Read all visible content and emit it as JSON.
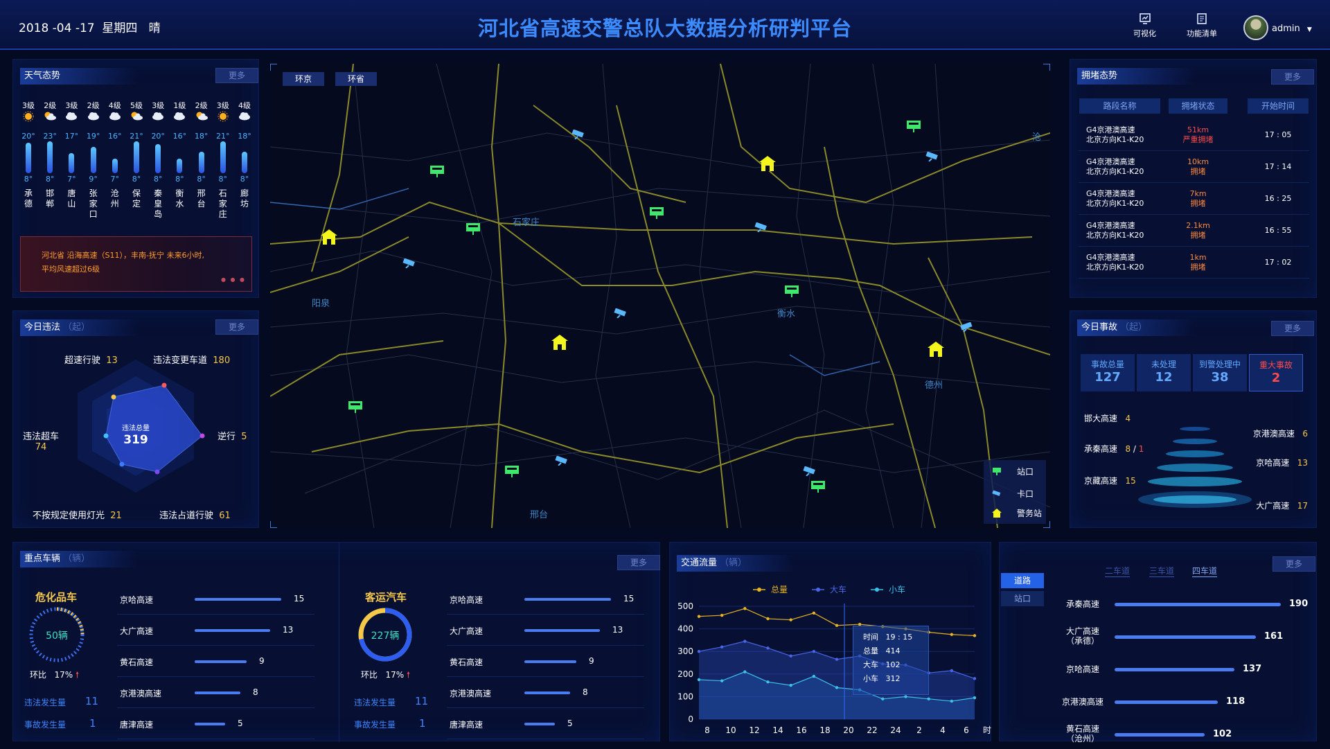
{
  "header": {
    "date": "2018 -04 -17",
    "weekday": "星期四",
    "weather": "晴",
    "title": "河北省高速交警总队大数据分析研判平台",
    "nav_visual": "可视化",
    "nav_functions": "功能清单",
    "user": "admin"
  },
  "weather_panel": {
    "title": "天气态势",
    "more": "更多",
    "cities": [
      {
        "level": "3级",
        "icon": "sun",
        "high": "20°",
        "low": "8°",
        "name": [
          "承",
          "德"
        ],
        "hf": 0.95
      },
      {
        "level": "2级",
        "icon": "partly-cloudy",
        "high": "23°",
        "low": "8°",
        "name": [
          "邯",
          "郸"
        ],
        "hf": 1.0
      },
      {
        "level": "3级",
        "icon": "cloud",
        "high": "17°",
        "low": "7°",
        "name": [
          "唐",
          "山"
        ],
        "hf": 0.55
      },
      {
        "level": "2级",
        "icon": "cloud",
        "high": "19°",
        "low": "9°",
        "name": [
          "张",
          "家",
          "口"
        ],
        "hf": 0.8
      },
      {
        "level": "4级",
        "icon": "cloud",
        "high": "16°",
        "low": "7°",
        "name": [
          "沧",
          "州"
        ],
        "hf": 0.35
      },
      {
        "level": "5级",
        "icon": "partly-cloudy",
        "high": "21°",
        "low": "8°",
        "name": [
          "保",
          "定"
        ],
        "hf": 1.0
      },
      {
        "level": "3级",
        "icon": "cloud",
        "high": "20°",
        "low": "8°",
        "name": [
          "秦",
          "皇",
          "岛"
        ],
        "hf": 0.9
      },
      {
        "level": "1级",
        "icon": "cloud",
        "high": "16°",
        "low": "8°",
        "name": [
          "衡",
          "水"
        ],
        "hf": 0.35
      },
      {
        "level": "2级",
        "icon": "partly-cloudy",
        "high": "18°",
        "low": "8°",
        "name": [
          "邢",
          "台"
        ],
        "hf": 0.6
      },
      {
        "level": "3级",
        "icon": "sun",
        "high": "21°",
        "low": "8°",
        "name": [
          "石",
          "家",
          "庄"
        ],
        "hf": 1.0
      },
      {
        "level": "4级",
        "icon": "cloud",
        "high": "18°",
        "low": "8°",
        "name": [
          "廊",
          "坊"
        ],
        "hf": 0.6
      }
    ],
    "alert_line1": "河北省  沿海高速（S11），丰南-抚宁   未来6小时,",
    "alert_line2": "平均风速超过6级"
  },
  "violations": {
    "title": "今日违法",
    "unit": "（起）",
    "more": "更多",
    "total_label": "违法总量",
    "total": "319",
    "items": [
      {
        "label": "超速行驶",
        "value": "13"
      },
      {
        "label": "违法变更车道",
        "value": "180"
      },
      {
        "label": "逆行",
        "value": "5"
      },
      {
        "label": "违法占道行驶",
        "value": "61"
      },
      {
        "label": "不按规定使用灯光",
        "value": "21"
      },
      {
        "label": "违法超车",
        "value": "74"
      }
    ]
  },
  "map": {
    "tab1": "环京",
    "tab2": "环省",
    "city_labels": [
      "石家庄",
      "阳泉",
      "衡水",
      "德州",
      "邢台",
      "沧"
    ],
    "legend": [
      {
        "label": "站口"
      },
      {
        "label": "卡口"
      },
      {
        "label": "警务站"
      }
    ]
  },
  "congestion": {
    "title": "拥堵态势",
    "more": "更多",
    "headers": [
      "路段名称",
      "拥堵状态",
      "开始时间"
    ],
    "rows": [
      {
        "road1": "G4京港澳高速",
        "road2": "北京方向K1-K20",
        "dist": "51km",
        "status": "严重拥堵",
        "time": "17 : 05",
        "color": "#ff4b4b"
      },
      {
        "road1": "G4京港澳高速",
        "road2": "北京方向K1-K20",
        "dist": "10km",
        "status": "拥堵",
        "time": "17 : 14",
        "color": "#ff8a3d"
      },
      {
        "road1": "G4京港澳高速",
        "road2": "北京方向K1-K20",
        "dist": "7km",
        "status": "拥堵",
        "time": "16 : 25",
        "color": "#ff8a3d"
      },
      {
        "road1": "G4京港澳高速",
        "road2": "北京方向K1-K20",
        "dist": "2.1km",
        "status": "拥堵",
        "time": "16 : 55",
        "color": "#ff8a3d"
      },
      {
        "road1": "G4京港澳高速",
        "road2": "北京方向K1-K20",
        "dist": "1km",
        "status": "拥堵",
        "time": "17 : 02",
        "color": "#ff8a3d"
      }
    ]
  },
  "accidents": {
    "title": "今日事故",
    "unit": "（起）",
    "more": "更多",
    "stats": [
      {
        "label": "事故总量",
        "value": "127"
      },
      {
        "label": "未处理",
        "value": "12"
      },
      {
        "label": "到警处理中",
        "value": "38"
      },
      {
        "label": "重大事故",
        "value": "2"
      }
    ],
    "left_roads": [
      {
        "name": "邯大高速",
        "value": "4"
      },
      {
        "name": "承秦高速",
        "value": "8",
        "value2": "1"
      },
      {
        "name": "京藏高速",
        "value": "15"
      }
    ],
    "right_roads": [
      {
        "name": "京港澳高速",
        "value": "6"
      },
      {
        "name": "京哈高速",
        "value": "13"
      },
      {
        "name": "大广高速",
        "value": "17"
      }
    ]
  },
  "key_vehicles": {
    "title": "重点车辆",
    "unit": "（辆）",
    "more": "更多",
    "hazmat": {
      "title": "危化品车",
      "count": "50辆",
      "ratio_label": "环比",
      "ratio": "17%",
      "viol_label": "违法发生量",
      "viol": "11",
      "acc_label": "事故发生量",
      "acc": "1"
    },
    "passenger": {
      "title": "客运汽车",
      "count": "227辆",
      "ratio_label": "环比",
      "ratio": "17%",
      "viol_label": "违法发生量",
      "viol": "11",
      "acc_label": "事故发生量",
      "acc": "1",
      "ring_fraction": 0.72
    },
    "roads1": [
      {
        "name": "京哈高速",
        "value": "15",
        "f": 1.0
      },
      {
        "name": "大广高速",
        "value": "13",
        "f": 0.87
      },
      {
        "name": "黄石高速",
        "value": "9",
        "f": 0.6
      },
      {
        "name": "京港澳高速",
        "value": "8",
        "f": 0.53
      },
      {
        "name": "唐津高速",
        "value": "5",
        "f": 0.35
      }
    ],
    "roads2": [
      {
        "name": "京哈高速",
        "value": "15",
        "f": 1.0
      },
      {
        "name": "大广高速",
        "value": "13",
        "f": 0.87
      },
      {
        "name": "黄石高速",
        "value": "9",
        "f": 0.6
      },
      {
        "name": "京港澳高速",
        "value": "8",
        "f": 0.53
      },
      {
        "name": "唐津高速",
        "value": "5",
        "f": 0.35
      }
    ]
  },
  "traffic": {
    "title": "交通流量",
    "unit": "（辆）",
    "tooltip": {
      "time_label": "时间",
      "time": "19 : 15",
      "total_label": "总量",
      "total": "414",
      "big_label": "大车",
      "big": "102",
      "small_label": "小车",
      "small": "312"
    },
    "x_unit": "时"
  },
  "chart_data": {
    "type": "line",
    "x": [
      "8",
      "10",
      "12",
      "14",
      "16",
      "18",
      "20",
      "22",
      "24",
      "2",
      "4",
      "6"
    ],
    "ylim": [
      0,
      500
    ],
    "yticks": [
      0,
      100,
      200,
      300,
      400,
      500
    ],
    "series": [
      {
        "name": "总量",
        "color": "#e6b422",
        "values": [
          455,
          460,
          490,
          445,
          440,
          470,
          415,
          420,
          410,
          400,
          385,
          375,
          370
        ]
      },
      {
        "name": "大车",
        "color": "#4a66e8",
        "values": [
          300,
          320,
          345,
          315,
          280,
          300,
          265,
          280,
          245,
          240,
          205,
          215,
          180
        ]
      },
      {
        "name": "小车",
        "color": "#3cc2e8",
        "values": [
          175,
          170,
          210,
          165,
          150,
          190,
          140,
          130,
          90,
          100,
          90,
          80,
          95
        ]
      }
    ]
  },
  "lane_panel": {
    "btn_road": "道路",
    "btn_station": "站口",
    "more": "更多",
    "tabs": [
      "二车道",
      "三车道",
      "四车道"
    ],
    "rows": [
      {
        "name": "承秦高速",
        "name2": "",
        "value": "190",
        "f": 1.0
      },
      {
        "name": "大广高速",
        "name2": "（承德）",
        "value": "161",
        "f": 0.85
      },
      {
        "name": "京哈高速",
        "name2": "",
        "value": "137",
        "f": 0.72
      },
      {
        "name": "京港澳高速",
        "name2": "",
        "value": "118",
        "f": 0.62
      },
      {
        "name": "黄石高速",
        "name2": "（沧州）",
        "value": "102",
        "f": 0.54
      }
    ]
  }
}
